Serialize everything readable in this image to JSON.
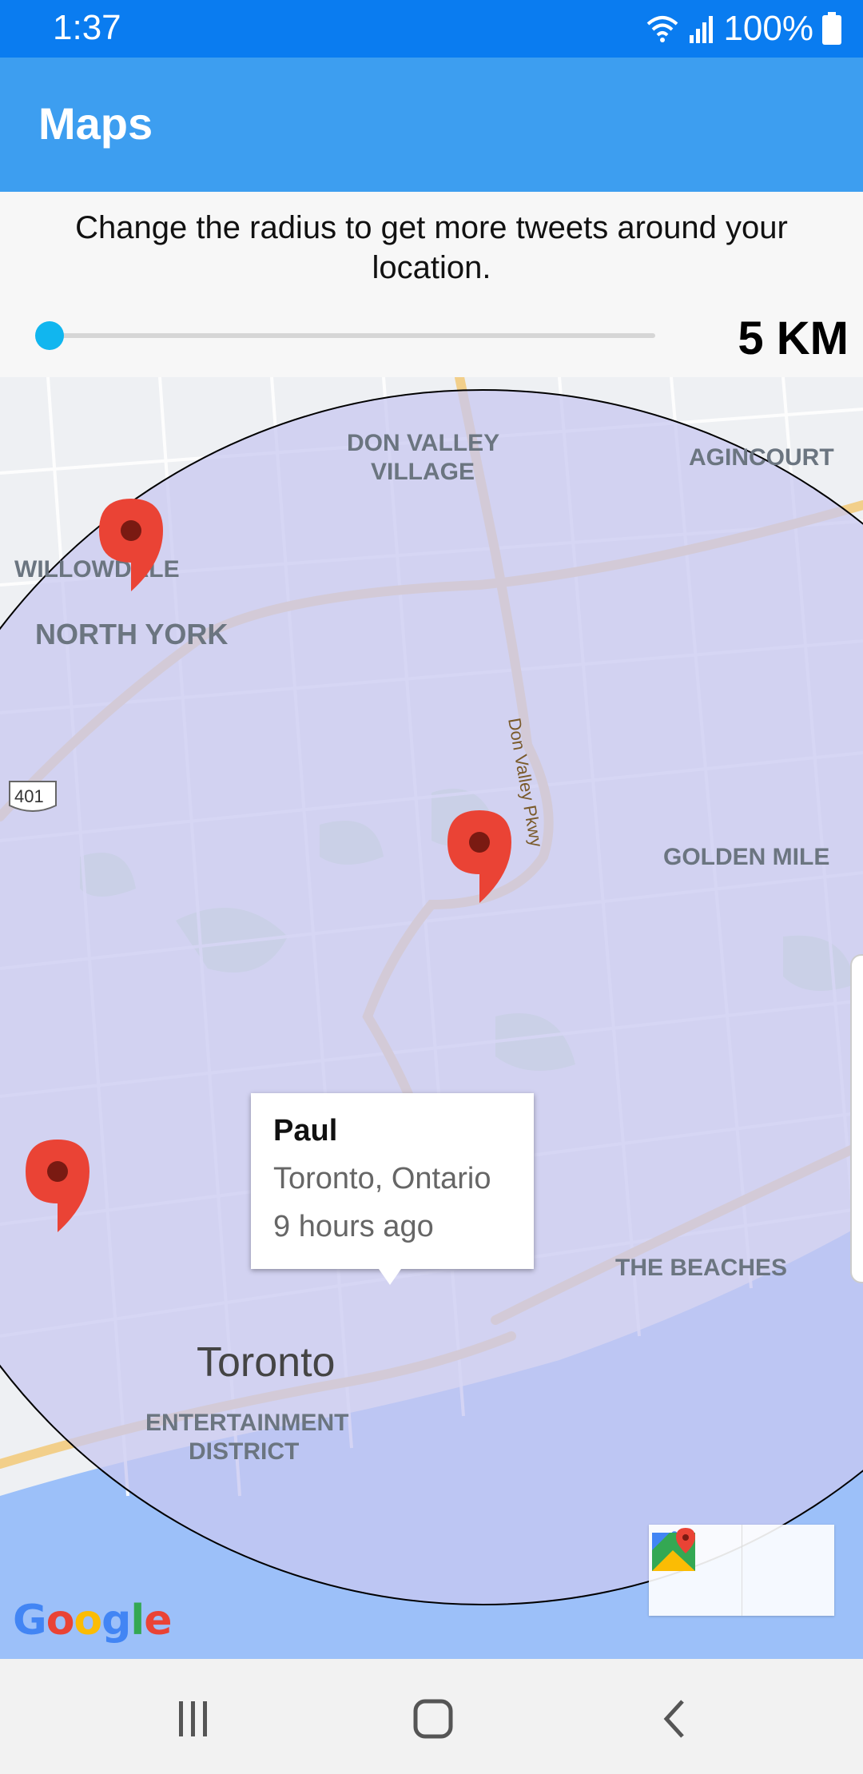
{
  "status": {
    "time": "1:37",
    "battery": "100%",
    "icons": [
      "wifi-icon",
      "signal-icon",
      "battery-icon"
    ]
  },
  "app": {
    "title": "Maps"
  },
  "controls": {
    "info": "Change the radius to get more tweets around your location.",
    "radius": "5 KM",
    "slider_fraction": 0.0
  },
  "map": {
    "labels": {
      "don_valley_1": "DON VALLEY",
      "don_valley_2": "VILLAGE",
      "agincourt": "AGINCOURT",
      "willowdale": "WILLOWDALE",
      "north_york": "NORTH YORK",
      "highway": "401",
      "dvp": "Don Valley Pkwy",
      "golden_mile": "GOLDEN MILE",
      "beaches": "THE BEACHES",
      "toronto": "Toronto",
      "entertainment_1": "ENTERTAINMENT",
      "entertainment_2": "DISTRICT"
    },
    "info_window": {
      "name": "Paul",
      "place": "Toronto, Ontario",
      "time": "9 hours ago"
    },
    "google": "Google",
    "colors": {
      "radius_fill": "#c8c8f0",
      "marker": "#ea4335",
      "water": "#9cc0f9"
    }
  },
  "nav": {
    "icons": [
      "recents-icon",
      "home-icon",
      "back-icon"
    ]
  }
}
